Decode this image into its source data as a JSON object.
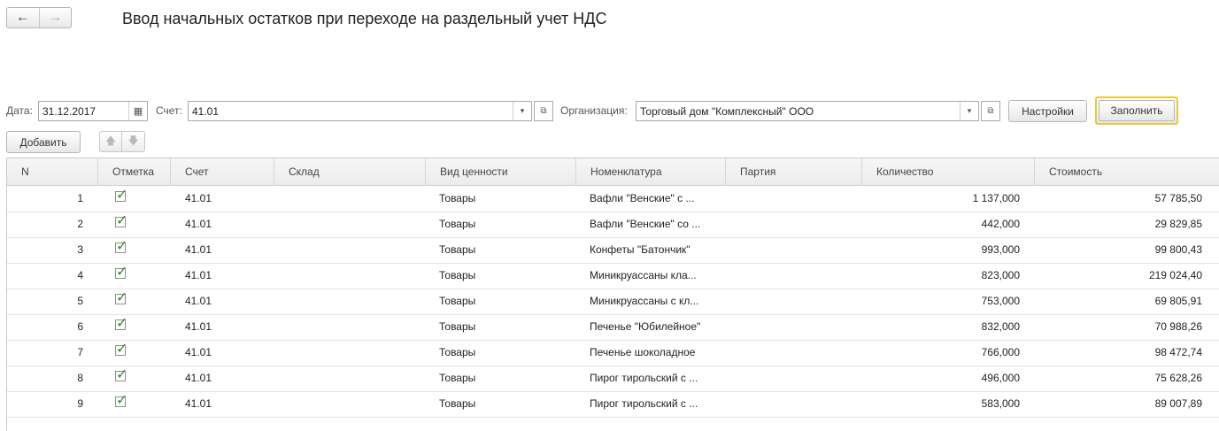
{
  "nav": {
    "back": "←",
    "forward": "→"
  },
  "title": "Ввод начальных остатков при переходе на раздельный учет НДС",
  "filters": {
    "date_label": "Дата:",
    "date_value": "31.12.2017",
    "account_label": "Счет:",
    "account_value": "41.01",
    "org_label": "Организация:",
    "org_value": "Торговый дом \"Комплексный\" ООО",
    "settings_button": "Настройки",
    "fill_button": "Заполнить"
  },
  "toolbar": {
    "add_button": "Добавить",
    "up_icon": "🡅",
    "down_icon": "🡇"
  },
  "table": {
    "columns": [
      "N",
      "Отметка",
      "Счет",
      "Склад",
      "Вид ценности",
      "Номенклатура",
      "Партия",
      "Количество",
      "Стоимость"
    ],
    "rows": [
      {
        "n": "1",
        "checked": true,
        "account": "41.01",
        "warehouse": "",
        "value_type": "Товары",
        "item": "Вафли \"Венские\" с ...",
        "batch": "",
        "qty": "1 137,000",
        "cost": "57 785,50"
      },
      {
        "n": "2",
        "checked": true,
        "account": "41.01",
        "warehouse": "",
        "value_type": "Товары",
        "item": "Вафли \"Венские\" со ...",
        "batch": "",
        "qty": "442,000",
        "cost": "29 829,85"
      },
      {
        "n": "3",
        "checked": true,
        "account": "41.01",
        "warehouse": "",
        "value_type": "Товары",
        "item": "Конфеты \"Батончик\"",
        "batch": "",
        "qty": "993,000",
        "cost": "99 800,43"
      },
      {
        "n": "4",
        "checked": true,
        "account": "41.01",
        "warehouse": "",
        "value_type": "Товары",
        "item": "Миникруассаны кла...",
        "batch": "",
        "qty": "823,000",
        "cost": "219 024,40"
      },
      {
        "n": "5",
        "checked": true,
        "account": "41.01",
        "warehouse": "",
        "value_type": "Товары",
        "item": "Миникруассаны с кл...",
        "batch": "",
        "qty": "753,000",
        "cost": "69 805,91"
      },
      {
        "n": "6",
        "checked": true,
        "account": "41.01",
        "warehouse": "",
        "value_type": "Товары",
        "item": "Печенье \"Юбилейное\"",
        "batch": "",
        "qty": "832,000",
        "cost": "70 988,26"
      },
      {
        "n": "7",
        "checked": true,
        "account": "41.01",
        "warehouse": "",
        "value_type": "Товары",
        "item": "Печенье шоколадное",
        "batch": "",
        "qty": "766,000",
        "cost": "98 472,74"
      },
      {
        "n": "8",
        "checked": true,
        "account": "41.01",
        "warehouse": "",
        "value_type": "Товары",
        "item": "Пирог тирольский с ...",
        "batch": "",
        "qty": "496,000",
        "cost": "75 628,26"
      },
      {
        "n": "9",
        "checked": true,
        "account": "41.01",
        "warehouse": "",
        "value_type": "Товары",
        "item": "Пирог тирольский с ...",
        "batch": "",
        "qty": "583,000",
        "cost": "89 007,89"
      }
    ]
  },
  "colors": {
    "check": "#2e8b2e",
    "fill_button_border": "#e8c93a"
  }
}
